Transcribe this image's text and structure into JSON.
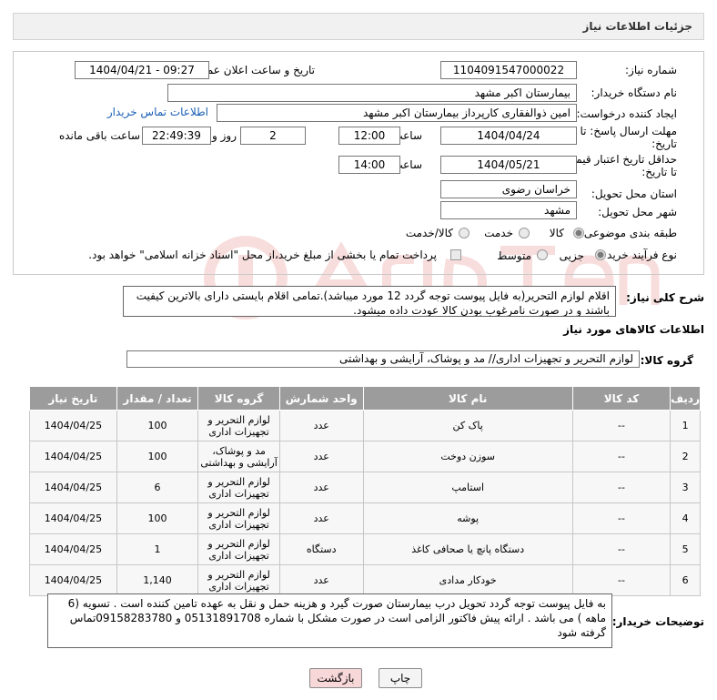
{
  "header": {
    "title": "جزئیات اطلاعات نیاز"
  },
  "fields": {
    "need_number_label": "شماره نیاز:",
    "need_number": "1104091547000022",
    "announce_label": "تاریخ و ساعت اعلان عمومی:",
    "announce_value": "1404/04/21 - 09:27",
    "buyer_org_label": "نام دستگاه خریدار:",
    "buyer_org": "بیمارستان اکبر مشهد",
    "creator_label": "ایجاد کننده درخواست:",
    "creator": "امین ذوالفقاری کارپرداز بیمارستان اکبر مشهد",
    "contact_link": "اطلاعات تماس خریدار",
    "reply_deadline_label_1": "مهلت ارسال پاسخ: تا",
    "reply_deadline_label_2": "تاریخ:",
    "reply_date": "1404/04/24",
    "time_label": "ساعت",
    "reply_time": "12:00",
    "days_value": "2",
    "days_label": "روز و",
    "remaining_time": "22:49:39",
    "remaining_label": "ساعت باقی مانده",
    "price_validity_label_1": "حداقل تاریخ اعتبار قیمت:",
    "price_validity_label_2": "تا تاریخ:",
    "validity_date": "1404/05/21",
    "validity_time": "14:00",
    "province_label": "استان محل تحویل:",
    "province": "خراسان رضوی",
    "city_label": "شهر محل تحویل:",
    "city": "مشهد",
    "category_label": "طبقه بندی موضوعی:",
    "category_options": [
      "کالا",
      "خدمت",
      "کالا/خدمت"
    ],
    "category_selected": "کالا",
    "process_label": "نوع فرآیند خرید :",
    "process_options": [
      "جزیی",
      "متوسط"
    ],
    "process_selected": "جزیی",
    "treasury_note": "پرداخت تمام یا بخشی از مبلغ خرید،از محل \"اسناد خزانه اسلامی\" خواهد بود."
  },
  "summary": {
    "label": "شرح کلی نیاز:",
    "text": "اقلام لوازم التحریر(به فایل پیوست توجه گردد 12 مورد میباشد).تمامی اقلام بایستی دارای بالاترین کیفیت باشند و در صورت نامرغوب بودن کالا عودت داده میشود."
  },
  "goods_section": {
    "title": "اطلاعات کالاهای مورد نیاز",
    "group_label": "گروه کالا:",
    "group_value": "لوازم التحریر و تجهیزات اداری// مد و پوشاک، آرایشی و بهداشتی"
  },
  "table": {
    "headers": [
      "ردیف",
      "کد کالا",
      "نام کالا",
      "واحد شمارش",
      "گروه کالا",
      "تعداد / مقدار",
      "تاریخ نیاز"
    ],
    "rows": [
      {
        "row": "1",
        "code": "--",
        "name": "پاک کن",
        "unit": "عدد",
        "group": "لوازم التحریر و تجهیزات اداری",
        "qty": "100",
        "date": "1404/04/25"
      },
      {
        "row": "2",
        "code": "--",
        "name": "سوزن دوخت",
        "unit": "عدد",
        "group": "مد و پوشاک، آرایشی و بهداشتی",
        "qty": "100",
        "date": "1404/04/25"
      },
      {
        "row": "3",
        "code": "--",
        "name": "استامپ",
        "unit": "عدد",
        "group": "لوازم التحریر و تجهیزات اداری",
        "qty": "6",
        "date": "1404/04/25"
      },
      {
        "row": "4",
        "code": "--",
        "name": "پوشه",
        "unit": "عدد",
        "group": "لوازم التحریر و تجهیزات اداری",
        "qty": "100",
        "date": "1404/04/25"
      },
      {
        "row": "5",
        "code": "--",
        "name": "دستگاه پانچ یا صحافی کاغذ",
        "unit": "دستگاه",
        "group": "لوازم التحریر و تجهیزات اداری",
        "qty": "1",
        "date": "1404/04/25"
      },
      {
        "row": "6",
        "code": "--",
        "name": "خودکار مدادی",
        "unit": "عدد",
        "group": "لوازم التحریر و تجهیزات اداری",
        "qty": "1,140",
        "date": "1404/04/25"
      }
    ]
  },
  "buyer_notes": {
    "label": "توضیحات خریدار:",
    "text": "به فایل پیوست توجه گردد تحویل درب بیمارستان صورت گیرد و هزینه حمل و نقل به عهده تامین کننده است . تسویه (6 ماهه ) می باشد . ارائه پیش فاکتور الزامی است در صورت مشکل با شماره 05131891708  و 09158283780تماس گرفته شود"
  },
  "buttons": {
    "print": "چاپ",
    "back": "بازگشت"
  },
  "colors": {
    "table_header": "#9c9c9c",
    "link": "#1a5fb4",
    "back_button": "#f7d7d7"
  }
}
